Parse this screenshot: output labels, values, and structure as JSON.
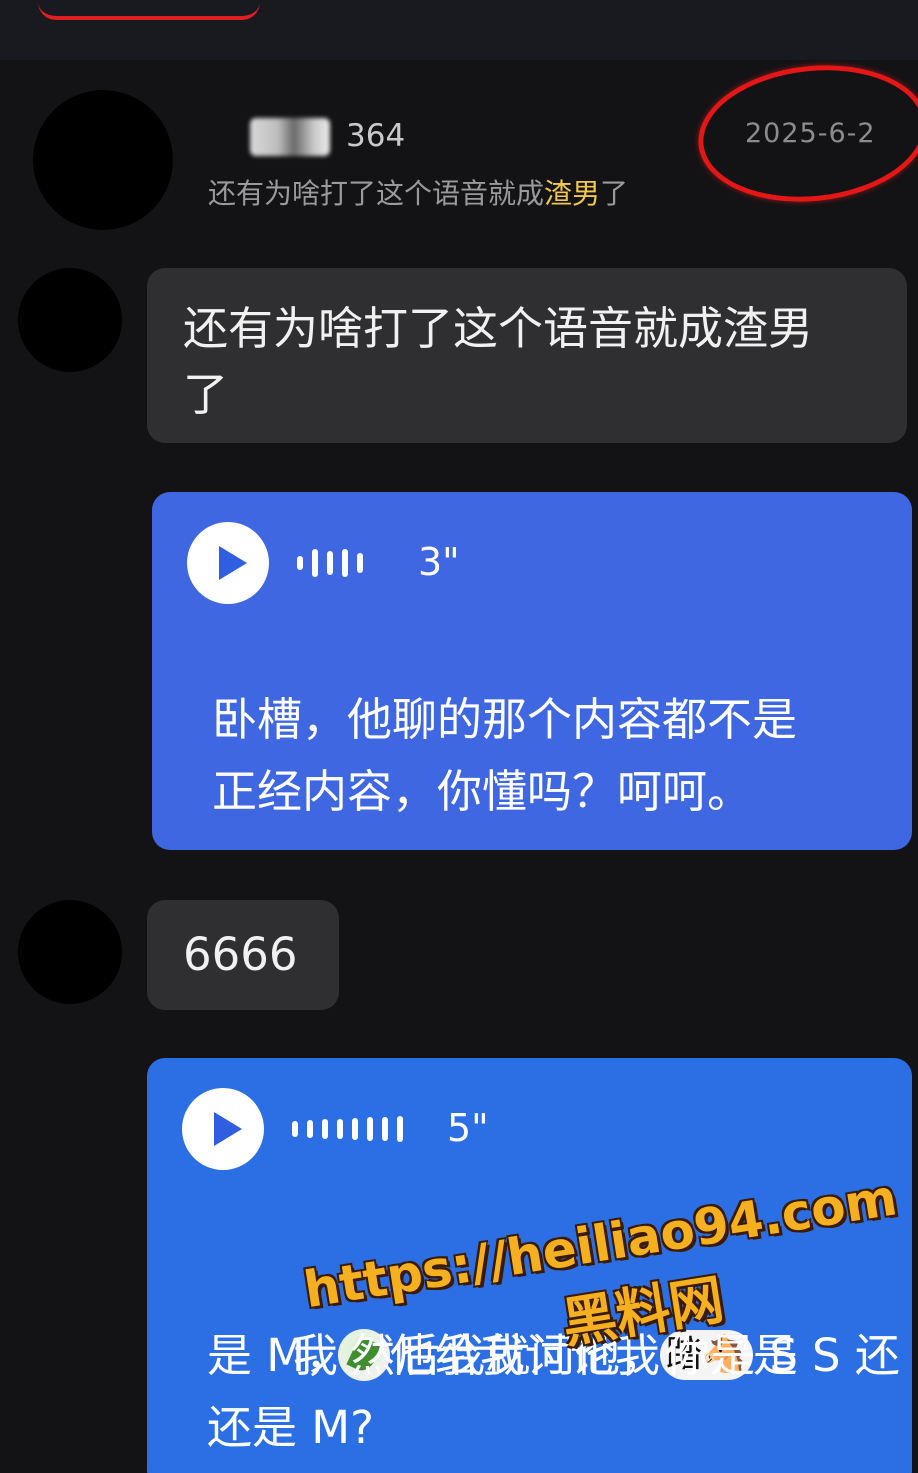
{
  "header": {
    "username": "364",
    "date": "2025-6-2",
    "preview_prefix": "还有为啥打了这个语音就成",
    "preview_highlight": "渣男",
    "preview_suffix": "了"
  },
  "messages": [
    {
      "type": "text",
      "text": "还有为啥打了这个语音就成渣男\n了"
    },
    {
      "type": "voice",
      "duration": "3\"",
      "transcript": "卧槽，他聊的那个内容都不是\n正经内容，你懂吗？呵呵。"
    },
    {
      "type": "text",
      "text": "6666"
    },
    {
      "type": "voice",
      "duration": "5\"",
      "transcript_line1_a": "我",
      "transcript_line1_b": "他给我讨论我",
      "sticker_text": "踏🐴",
      "transcript_line1_c": "是 S 还",
      "transcript_line2": "是 M，然后我就问他，你是 S",
      "transcript_line3": "还是 M?"
    }
  ],
  "watermark": {
    "url": "https://heiliao94.com",
    "name": "黑料网"
  },
  "colors": {
    "background": "#131315",
    "bubble_dark": "#2f2f31",
    "bubble_blue_1": "#3f67e2",
    "bubble_blue_2": "#2c6fe4",
    "highlight": "#f4c84a",
    "annotation_red": "#e51616",
    "watermark": "#f5b020"
  },
  "icons": [
    "play-icon",
    "waveform-icon",
    "leaf-emoji-icon"
  ]
}
